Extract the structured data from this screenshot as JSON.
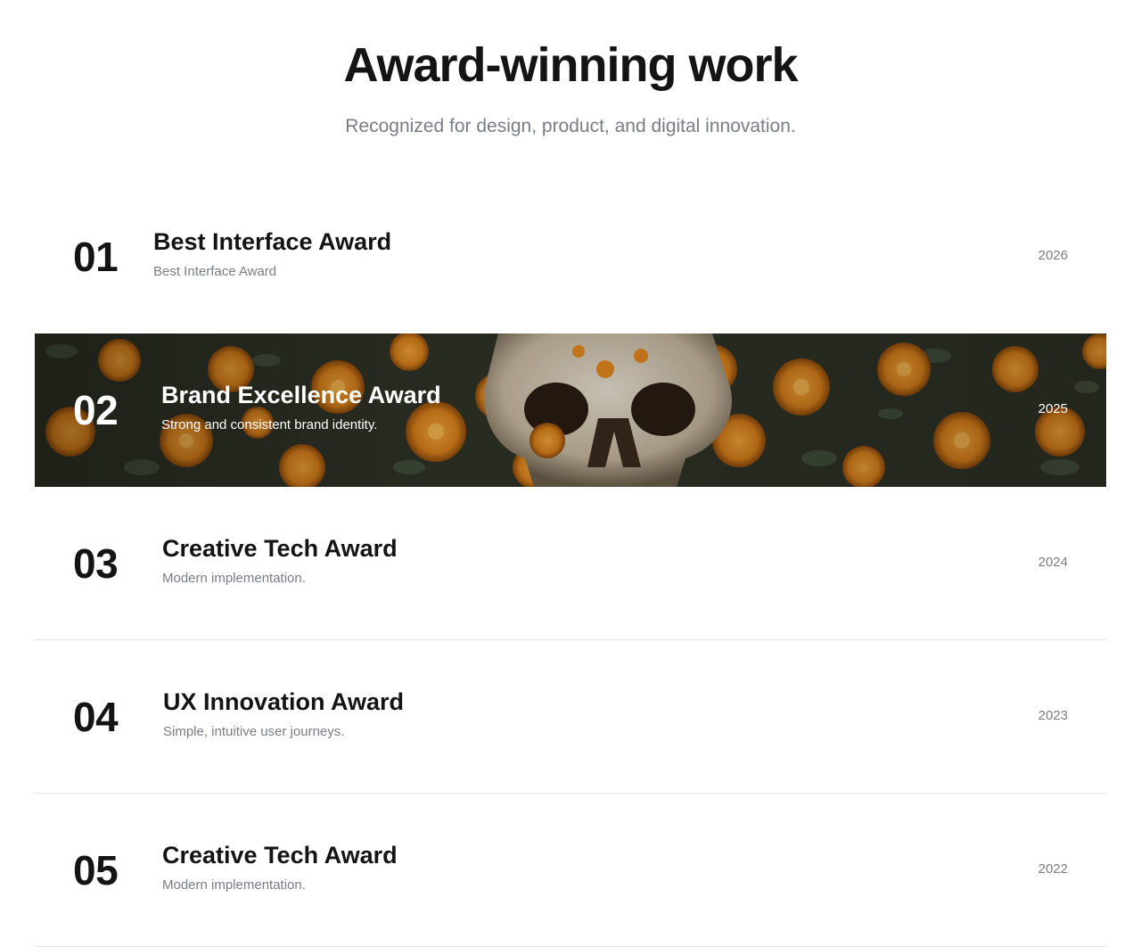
{
  "header": {
    "title": "Award-winning work",
    "subtitle": "Recognized for design, product, and digital innovation."
  },
  "awards": [
    {
      "number": "01",
      "name": "Best Interface Award",
      "description": "Best Interface Award",
      "year": "2026"
    },
    {
      "number": "02",
      "name": "Brand Excellence Award",
      "description": "Strong and consistent brand identity.",
      "year": "2025"
    },
    {
      "number": "03",
      "name": "Creative Tech Award",
      "description": "Modern implementation.",
      "year": "2024"
    },
    {
      "number": "04",
      "name": "UX Innovation Award",
      "description": "Simple, intuitive user journeys.",
      "year": "2023"
    },
    {
      "number": "05",
      "name": "Creative Tech Award",
      "description": "Modern implementation.",
      "year": "2022"
    }
  ],
  "colors": {
    "text": "#141414",
    "muted": "#7a7c86",
    "divider": "#e2e2e2",
    "featured_overlay": "#2b2619",
    "flower_orange": "#e08a1e"
  },
  "featured_image": "skull-and-orange-flowers-image"
}
